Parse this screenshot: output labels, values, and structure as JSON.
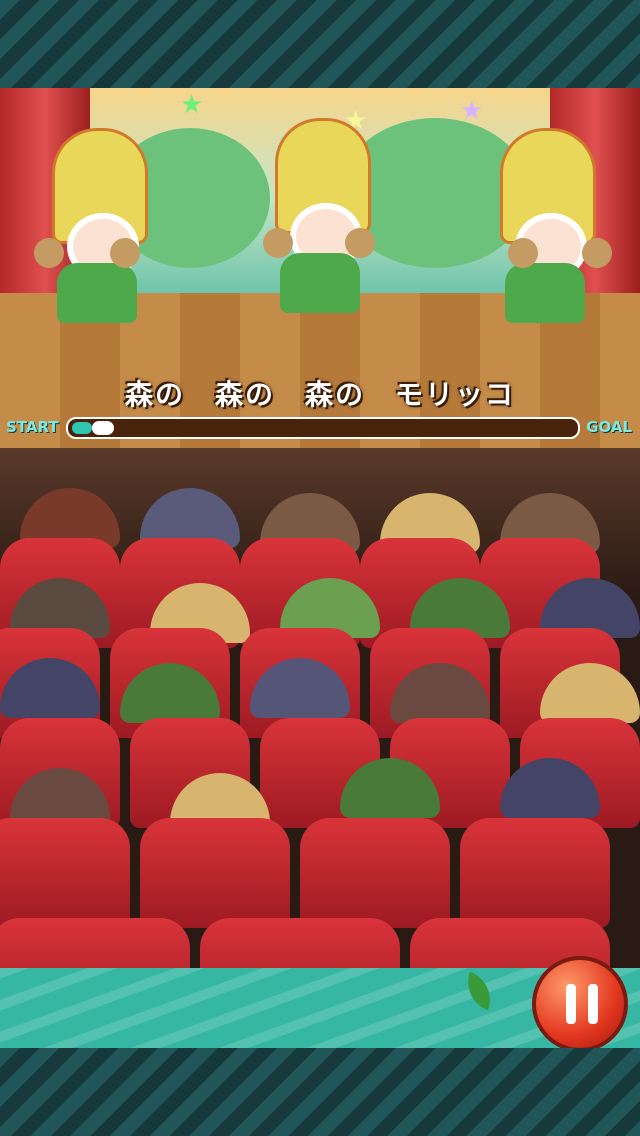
{
  "lyrics": {
    "line": "森の　森の　森の　モリッコ"
  },
  "progress": {
    "start_label": "START",
    "goal_label": "GOAL",
    "value": 0.04
  },
  "colors": {
    "curtain": "#c92f2f",
    "grass": "#36b7a3",
    "pause": "#e2361e"
  },
  "icons": {
    "pause": "pause-icon"
  }
}
